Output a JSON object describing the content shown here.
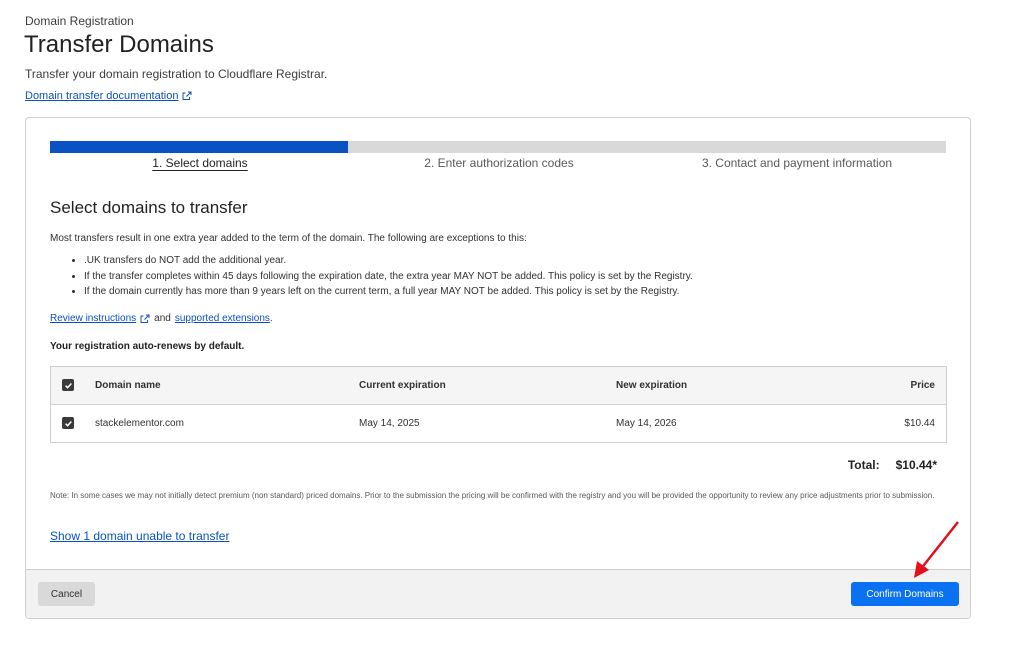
{
  "header": {
    "breadcrumb": "Domain Registration",
    "title": "Transfer Domains",
    "subtitle": "Transfer your domain registration to Cloudflare Registrar.",
    "doc_link": "Domain transfer documentation"
  },
  "progress": {
    "fraction": 0.333
  },
  "steps": [
    {
      "label": "1. Select domains",
      "active": true
    },
    {
      "label": "2. Enter authorization codes",
      "active": false
    },
    {
      "label": "3. Contact and payment information",
      "active": false
    }
  ],
  "section": {
    "title": "Select domains to transfer",
    "intro": "Most transfers result in one extra year added to the term of the domain. The following are exceptions to this:",
    "bullets": [
      ".UK transfers do NOT add the additional year.",
      "If the transfer completes within 45 days following the expiration date, the extra year MAY NOT be added. This policy is set by the Registry.",
      "If the domain currently has more than 9 years left on the current term, a full year MAY NOT be added. This policy is set by the Registry."
    ],
    "review_link": "Review instructions",
    "and_text": "and",
    "extensions_link": "supported extensions",
    "period": ".",
    "autorenew": "Your registration auto-renews by default."
  },
  "table": {
    "columns": [
      "Domain name",
      "Current expiration",
      "New expiration",
      "Price"
    ],
    "rows": [
      {
        "domain": "stackelementor.com",
        "current": "May 14, 2025",
        "new": "May 14, 2026",
        "price": "$10.44",
        "checked": true
      }
    ]
  },
  "total": {
    "label": "Total:",
    "value": "$10.44*"
  },
  "note": "Note: In some cases we may not initially detect premium (non standard) priced domains. Prior to the submission the pricing will be confirmed with the registry and you will be provided the opportunity to review any price adjustments prior to submission.",
  "show_unable": "Show 1 domain unable to transfer",
  "footer": {
    "cancel": "Cancel",
    "confirm": "Confirm Domains"
  },
  "colors": {
    "accent": "#0a51c2",
    "button": "#0a72f2",
    "arrow": "#e3101a"
  }
}
